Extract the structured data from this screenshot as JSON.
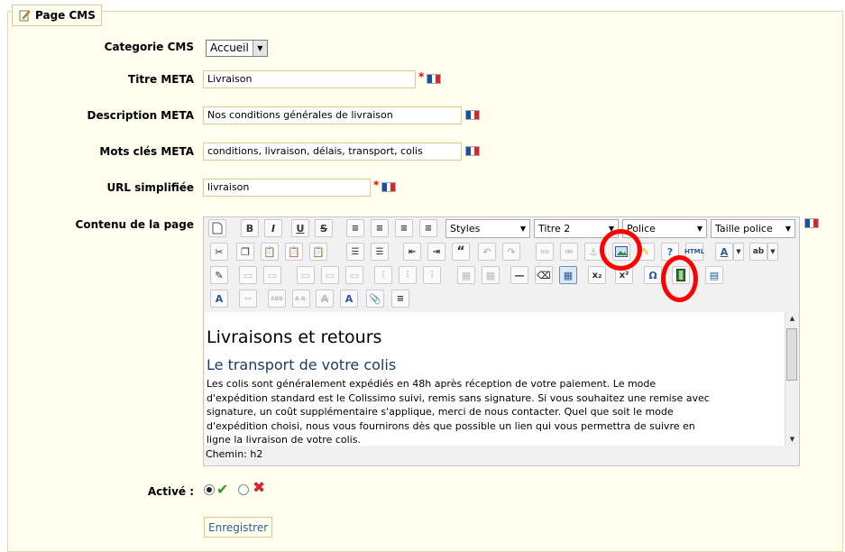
{
  "fieldset": {
    "legend": "Page CMS",
    "legend_icon": "edit-page-icon"
  },
  "fields": {
    "category": {
      "label": "Categorie CMS",
      "value": "Accueil"
    },
    "meta_title": {
      "label": "Titre META",
      "value": "Livraison",
      "required": "*"
    },
    "meta_description": {
      "label": "Description META",
      "value": "Nos conditions générales de livraison"
    },
    "meta_keywords": {
      "label": "Mots clés META",
      "value": "conditions, livraison, délais, transport, colis"
    },
    "friendly_url": {
      "label": "URL simplifiée",
      "value": "livraison",
      "required": "*"
    },
    "content": {
      "label": "Contenu de la page"
    }
  },
  "editor": {
    "styles_dropdown": "Styles",
    "format_dropdown": "Titre 2",
    "font_dropdown": "Police",
    "size_dropdown": "Taille police",
    "heading": "Livraisons et retours",
    "subheading": "Le transport de votre colis",
    "paragraph": "Les colis sont généralement expédiés en 48h après réception de votre paiement. Le mode d'expédition standard est le Colissimo suivi, remis sans signature. Si vous souhaitez une remise avec signature, un coût supplémentaire s'applique, merci de nous contacter. Quel que soit le mode d'expédition choisi, nous vous fournirons dès que possible un lien qui vous permettra de suivre en ligne la livraison de votre colis.",
    "path": "Chemin: h2"
  },
  "active": {
    "label": "Activé :",
    "yes_icon": "check-icon",
    "no_icon": "cross-icon"
  },
  "save_button": "Enregistrer",
  "colors": {
    "annotation": "#ff0000",
    "field_border": "#e0c98b",
    "background": "#fffff0"
  }
}
